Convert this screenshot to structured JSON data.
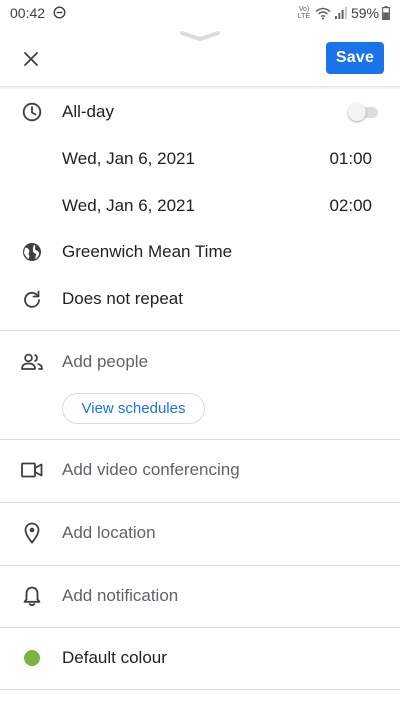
{
  "status_bar": {
    "time": "00:42",
    "volte_line1": "Vo)",
    "volte_line2": "LTE",
    "battery": "59%"
  },
  "header": {
    "save_label": "Save"
  },
  "rows": {
    "all_day_label": "All-day",
    "all_day_on": false,
    "start_date": "Wed, Jan 6, 2021",
    "start_time": "01:00",
    "end_date": "Wed, Jan 6, 2021",
    "end_time": "02:00",
    "time_zone": "Greenwich Mean Time",
    "repeat": "Does not repeat",
    "add_people": "Add people",
    "view_schedules": "View schedules",
    "video_conferencing": "Add video conferencing",
    "location": "Add location",
    "notification": "Add notification",
    "colour": "Default colour",
    "colour_hex": "#7cb342"
  },
  "colors": {
    "accent": "#1a73e8",
    "divider": "#dadce0",
    "secondary_text": "#5f6368"
  },
  "icons": {
    "close": "close-icon",
    "clock": "clock-icon",
    "globe": "globe-icon",
    "repeat": "repeat-icon",
    "people": "people-icon",
    "video": "video-icon",
    "location": "location-pin-icon",
    "notification": "bell-icon"
  }
}
